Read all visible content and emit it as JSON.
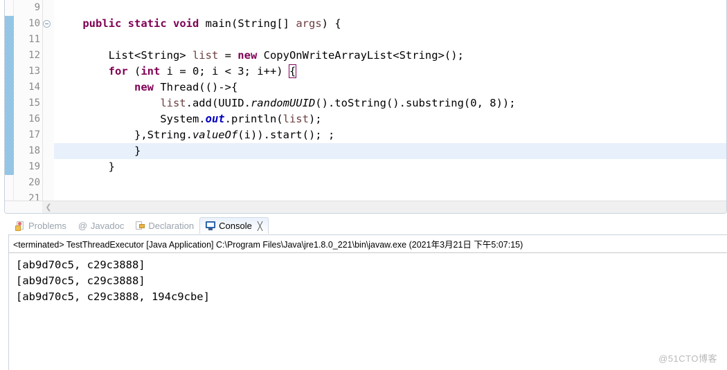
{
  "editor": {
    "first_line_number": 9,
    "current_line": 18,
    "change_marker_from_line": 10,
    "change_marker_to_line": 19,
    "scroll_arrow_icon": "chevron-left-icon",
    "lines": [
      {
        "num": "9",
        "fold": false,
        "text": ""
      },
      {
        "num": "10",
        "fold": true,
        "text": "    public static void main(String[] args) {"
      },
      {
        "num": "11",
        "fold": false,
        "text": ""
      },
      {
        "num": "12",
        "fold": false,
        "text": "        List<String> list = new CopyOnWriteArrayList<String>();"
      },
      {
        "num": "13",
        "fold": false,
        "text": "        for (int i = 0; i < 3; i++) {"
      },
      {
        "num": "14",
        "fold": false,
        "text": "            new Thread(()->{"
      },
      {
        "num": "15",
        "fold": false,
        "text": "                list.add(UUID.randomUUID().toString().substring(0, 8));"
      },
      {
        "num": "16",
        "fold": false,
        "text": "                System.out.println(list);"
      },
      {
        "num": "17",
        "fold": false,
        "text": "            },String.valueOf(i)).start(); ;"
      },
      {
        "num": "18",
        "fold": false,
        "text": "            }"
      },
      {
        "num": "19",
        "fold": false,
        "text": "        }"
      },
      {
        "num": "20",
        "fold": false,
        "text": ""
      },
      {
        "num": "21",
        "fold": false,
        "text": ""
      }
    ]
  },
  "console": {
    "tabs": [
      {
        "label": "Problems",
        "icon": "problems-icon",
        "active": false,
        "closable": false
      },
      {
        "label": "Javadoc",
        "icon": "javadoc-at-icon",
        "active": false,
        "closable": false
      },
      {
        "label": "Declaration",
        "icon": "declaration-icon",
        "active": false,
        "closable": false
      },
      {
        "label": "Console",
        "icon": "console-icon",
        "active": true,
        "closable": true
      }
    ],
    "close_glyph": "╳",
    "terminated_line": "<terminated> TestThreadExecutor [Java Application] C:\\Program Files\\Java\\jre1.8.0_221\\bin\\javaw.exe (2021年3月21日 下午5:07:15)",
    "output_lines": [
      "[ab9d70c5, c29c3888]",
      "[ab9d70c5, c29c3888]",
      "[ab9d70c5, c29c3888, 194c9cbe]"
    ]
  },
  "watermark": "@51CTO博客",
  "colors": {
    "keyword": "#7f0055",
    "local_var": "#6a3e3e",
    "static_field": "#0000c0",
    "current_line_highlight": "#e8f0fc",
    "change_bar": "#2a8ccb",
    "panel_border": "#c8d2dd"
  }
}
